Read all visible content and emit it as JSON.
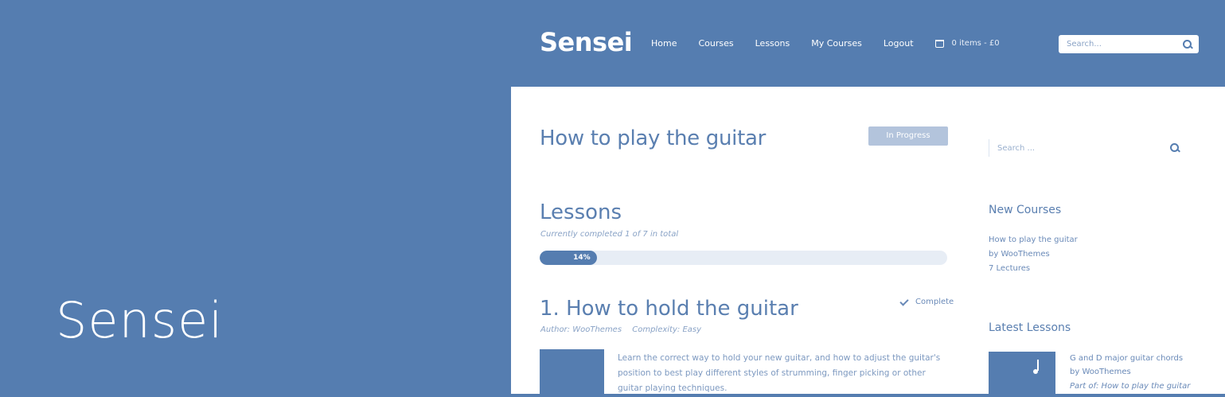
{
  "hero": {
    "brand": "Sensei"
  },
  "header": {
    "logo": "Sensei",
    "nav": [
      "Home",
      "Courses",
      "Lessons",
      "My Courses",
      "Logout"
    ],
    "cart": "0 items - £0",
    "search_placeholder": "Search..."
  },
  "course": {
    "title": "How to play the guitar",
    "status_badge": "In Progress",
    "lessons_heading": "Lessons",
    "progress_text": "Currently completed 1 of 7 in total",
    "progress_percent": 14,
    "progress_label": "14%"
  },
  "lesson": {
    "title": "1. How to hold the guitar",
    "status": "Complete",
    "author_label": "Author: ",
    "author": "WooThemes",
    "complexity_label": "Complexity: ",
    "complexity": "Easy",
    "description": "Learn the correct way to hold your new guitar, and how to adjust the guitar's position to best play different styles of strumming, finger picking or other guitar playing techniques."
  },
  "sidebar": {
    "search_placeholder": "Search ...",
    "new_courses": {
      "title": "New Courses",
      "course_name": "How to play the guitar",
      "byline": "by WooThemes",
      "lectures": "7 Lectures"
    },
    "latest_lessons": {
      "title": "Latest Lessons",
      "lesson_name": "G and D major guitar chords",
      "byline": "by WooThemes",
      "part_of": "Part of: How to play the guitar"
    }
  },
  "colors": {
    "brand_blue": "#557db0",
    "text_blue": "#5a7fb0",
    "track": "#e7edf5"
  }
}
